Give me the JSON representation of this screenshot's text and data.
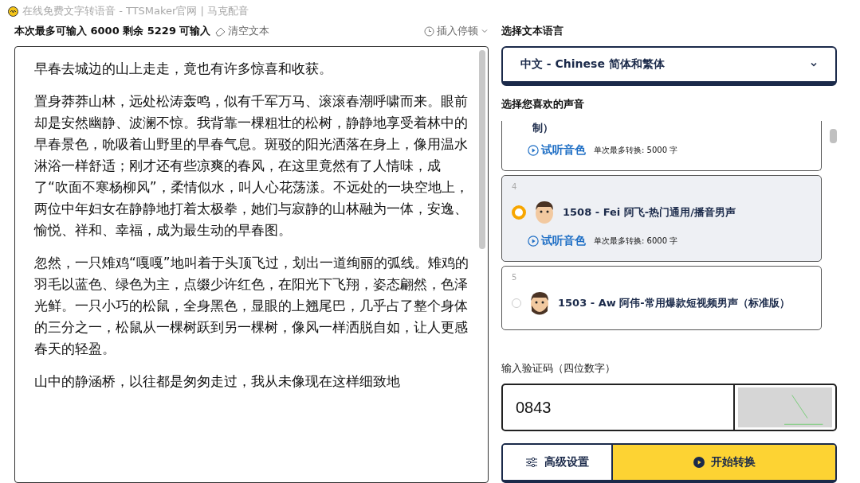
{
  "window": {
    "title": "在线免费文字转语音 - TTSMaker官网 | 马克配音"
  },
  "editor": {
    "limit_text": "本次最多可输入 6000 剩余 5229 可输入",
    "clear_button": "清空文本",
    "pause_button": "插入停顿",
    "paragraphs": [
      "早春去城边的山上走走，竟也有许多惊喜和收获。",
      "置身莽莽山林，远处松涛轰鸣，似有千军万马、滚滚春潮呼啸而来。眼前却是安然幽静、波澜不惊。我背靠一棵粗壮的松树，静静地享受着林中的早春景色，吮吸着山野里的早春气息。斑驳的阳光洒落在身上，像用温水淋浴一样舒适；刚才还有些凉爽的春风，在这里竟然有了人情味，成了“吹面不寒杨柳风”，柔情似水，叫人心花荡漾。不远处的一块空地上，两位中年妇女在静静地打着太极拳，她们与寂静的山林融为一体，安逸、愉悦、祥和、幸福，成为最生动的早春图。",
      "忽然，一只雉鸡“嘎嘎”地叫着于头顶飞过，划出一道绚丽的弧线。雉鸡的羽毛以蓝色、绿色为主，点缀少许红色，在阳光下飞翔，姿态翩然，色泽光鲜。一只小巧的松鼠，全身黑色，显眼的上翘尾巴，几乎占了整个身体的三分之一，松鼠从一棵树跃到另一棵树，像风一样洒脱自如，让人更感春天的轻盈。",
      "山中的静涵桥，以往都是匆匆走过，我从未像现在这样细致地"
    ]
  },
  "language": {
    "label": "选择文本语言",
    "value": "中文 - Chinese 简体和繁体"
  },
  "voices": {
    "label": "选择您喜欢的声音",
    "items": [
      {
        "name": "制）",
        "listen": "试听音色",
        "limit": "单次最多转换: 5000 字",
        "selected": false
      },
      {
        "number": "4",
        "name": "1508 - Fei 阿飞-热门通用/播音男声",
        "listen": "试听音色",
        "limit": "单次最多转换: 6000 字",
        "selected": true
      },
      {
        "number": "5",
        "name": "1503 - Aw 阿伟-常用爆款短视频男声（标准版）",
        "selected": false
      }
    ]
  },
  "captcha": {
    "label": "输入验证码（四位数字）",
    "value": "0843"
  },
  "buttons": {
    "advanced": "高级设置",
    "start": "开始转换"
  }
}
